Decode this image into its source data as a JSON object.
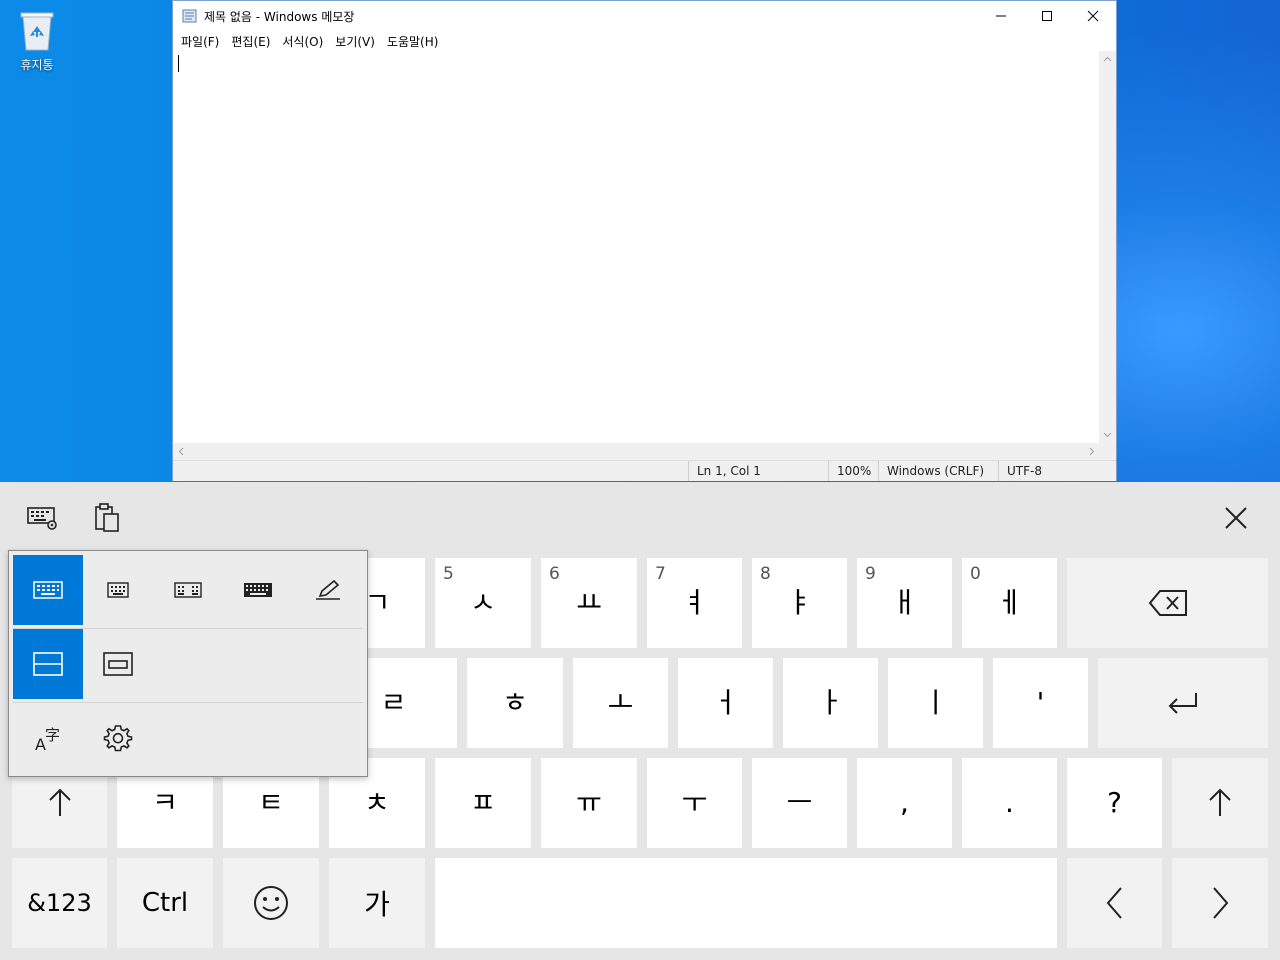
{
  "desktop": {
    "recycle_bin_label": "휴지통"
  },
  "notepad": {
    "title": "제목 없음 - Windows 메모장",
    "menu": [
      "파일(F)",
      "편집(E)",
      "서식(O)",
      "보기(V)",
      "도움말(H)"
    ],
    "status": {
      "position": "Ln 1, Col 1",
      "zoom": "100%",
      "line_ending": "Windows (CRLF)",
      "encoding": "UTF-8"
    }
  },
  "keyboard": {
    "row1": [
      {
        "num": "5",
        "char": "ㅅ"
      },
      {
        "num": "6",
        "char": "ㅛ"
      },
      {
        "num": "7",
        "char": "ㅕ"
      },
      {
        "num": "8",
        "char": "ㅑ"
      },
      {
        "num": "9",
        "char": "ㅐ"
      },
      {
        "num": "0",
        "char": "ㅔ"
      }
    ],
    "row1_partial": "ㄱ",
    "row2_partial": "ㄹ",
    "row2": [
      "ㅎ",
      "ㅗ",
      "ㅓ",
      "ㅏ",
      "ㅣ",
      "'"
    ],
    "row3": [
      "ㅋ",
      "ㅌ",
      "ㅊ",
      "ㅍ",
      "ㅠ",
      "ㅜ",
      "ㅡ",
      ",",
      ".",
      "?"
    ],
    "row4": {
      "symbols": "&123",
      "ctrl": "Ctrl",
      "lang": "가"
    },
    "accent_color": "#0078d7"
  }
}
